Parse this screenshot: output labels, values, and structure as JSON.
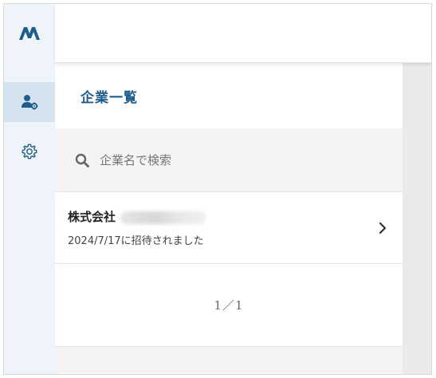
{
  "brand": {
    "logo_icon": "brand-logo-icon",
    "colors": {
      "accent": "#1f5d8c",
      "rail_bg": "#eef4fa",
      "rail_active": "#d5e2ef"
    }
  },
  "rail": {
    "items": [
      {
        "name": "user-settings",
        "icon": "user-gear-icon",
        "active": true
      },
      {
        "name": "settings",
        "icon": "gear-icon",
        "active": false
      }
    ]
  },
  "panel": {
    "title": "企業一覧",
    "search": {
      "placeholder": "企業名で検索",
      "value": ""
    },
    "companies": [
      {
        "name": "株式会社",
        "subtitle": "2024/7/17に招待されました"
      }
    ],
    "pager": "1／1"
  }
}
